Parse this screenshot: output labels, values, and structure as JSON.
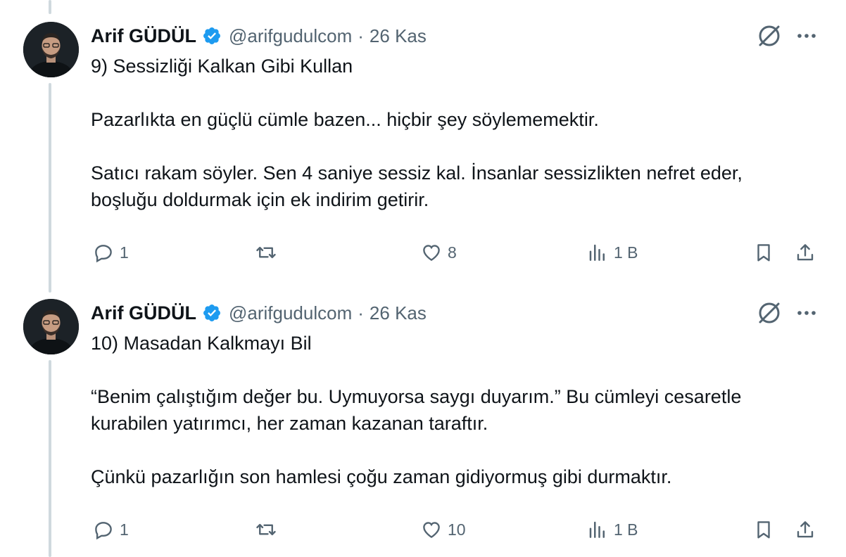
{
  "tweets": [
    {
      "author": {
        "name": "Arif GÜDÜL",
        "handle": "@arifgudulcom",
        "verified": true
      },
      "separator": "·",
      "date": "26 Kas",
      "text": [
        "9) Sessizliği Kalkan Gibi Kullan",
        "Pazarlıkta en güçlü cümle bazen... hiçbir şey söylememektir.",
        "Satıcı rakam söyler. Sen 4 saniye sessiz kal. İnsanlar sessizlikten nefret eder, boşluğu doldurmak için ek indirim getirir."
      ],
      "stats": {
        "replies": "1",
        "retweets": "",
        "likes": "8",
        "views": "1 B"
      }
    },
    {
      "author": {
        "name": "Arif GÜDÜL",
        "handle": "@arifgudulcom",
        "verified": true
      },
      "separator": "·",
      "date": "26 Kas",
      "text": [
        "10) Masadan Kalkmayı Bil",
        "“Benim çalıştığım değer bu. Uymuyorsa saygı duyarım.” Bu cümleyi cesaretle kurabilen yatırımcı, her zaman kazanan taraftır.",
        "Çünkü pazarlığın son hamlesi çoğu zaman gidiyormuş gibi durmaktır."
      ],
      "stats": {
        "replies": "1",
        "retweets": "",
        "likes": "10",
        "views": "1 B"
      }
    }
  ],
  "icons": {
    "verified": "verified-badge-icon",
    "grok": "grok-icon",
    "more": "more-icon",
    "reply": "reply-icon",
    "retweet": "retweet-icon",
    "like": "heart-icon",
    "views": "views-icon",
    "bookmark": "bookmark-icon",
    "share": "share-icon"
  },
  "colors": {
    "verified": "#1d9bf0",
    "muted": "#536471",
    "text": "#0f1419",
    "thread_line": "#cfd9de"
  }
}
